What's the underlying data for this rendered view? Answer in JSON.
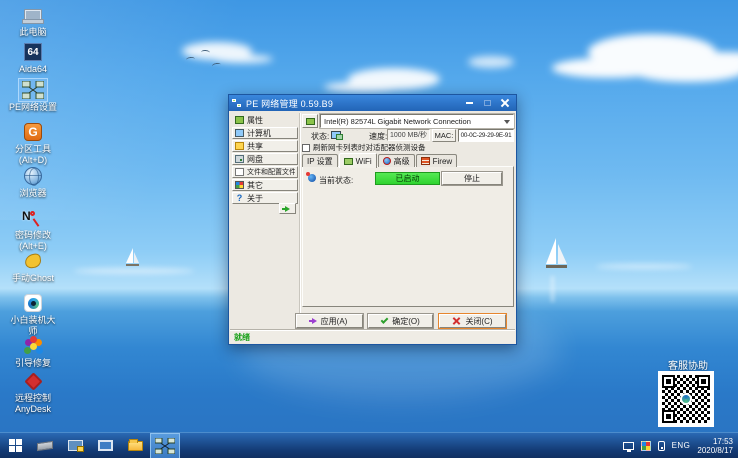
{
  "desktop": {
    "icons": [
      {
        "name": "this-pc",
        "label": "此电脑"
      },
      {
        "name": "aida64",
        "label": "Aida64",
        "badge": "64"
      },
      {
        "name": "pe-network-settings",
        "label": "PE网络设置"
      },
      {
        "name": "partition-tool",
        "label": "分区工具",
        "label2": "(Alt+D)",
        "badge": "G"
      },
      {
        "name": "browser",
        "label": "浏览器"
      },
      {
        "name": "password-edit",
        "label": "密码修改",
        "label2": "(Alt+E)",
        "badge": "N"
      },
      {
        "name": "manual-ghost",
        "label": "手动Ghost"
      },
      {
        "name": "xiaobai-installer",
        "label": "小白装机大",
        "label2": "师"
      },
      {
        "name": "boot-repair",
        "label": "引导修复"
      },
      {
        "name": "anydesk",
        "label": "远程控制",
        "label2": "AnyDesk"
      }
    ],
    "qr_caption": "客服协助"
  },
  "dialog": {
    "title": "PE 网络管理 0.59.B9",
    "sidebar": [
      {
        "label": "属性"
      },
      {
        "label": "计算机"
      },
      {
        "label": "共享"
      },
      {
        "label": "网盘"
      },
      {
        "label": "文件和配置文件"
      },
      {
        "label": "其它"
      },
      {
        "label": "关于"
      }
    ],
    "about_glyph": "?",
    "adapter": {
      "name": "Intel(R) 82574L Gigabit Network Connection",
      "status_label": "状态:",
      "speed_label": "速度:",
      "speed_value": "1000 MB/秒",
      "mac_label": "MAC:",
      "mac_value": "00-0C-29-29-9E-91",
      "refresh_option": "刷新网卡列表时对适配器侦测设备"
    },
    "tabs": [
      {
        "label": "IP 设置"
      },
      {
        "label": "WiFi"
      },
      {
        "label": "高级"
      },
      {
        "label": "Firew"
      }
    ],
    "wifi_tab": {
      "state_label": "当前状态:",
      "state_value": "已启动",
      "stop_button": "停止"
    },
    "footer": {
      "apply": "应用(A)",
      "ok": "确定(O)",
      "close": "关闭(C)"
    },
    "status_bar": "就绪"
  },
  "taskbar": {
    "tray": {
      "language": "ENG",
      "time": "17:53",
      "date": "2020/8/17"
    }
  },
  "colors": {
    "titlebar_blue": "#2f7bd3",
    "taskbar_blue": "#173f7c",
    "state_green": "#3fdf3f",
    "selection_blue": "#82bef5"
  }
}
